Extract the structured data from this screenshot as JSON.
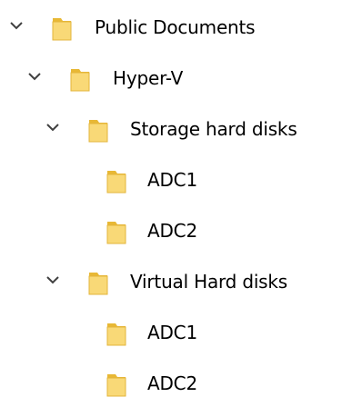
{
  "tree": {
    "items": [
      {
        "label": "Public Documents",
        "expanded": true,
        "level": 0,
        "icon": "folder-icon"
      },
      {
        "label": "Hyper-V",
        "expanded": true,
        "level": 1,
        "icon": "folder-icon"
      },
      {
        "label": "Storage hard disks",
        "expanded": true,
        "level": 2,
        "icon": "folder-icon"
      },
      {
        "label": "ADC1",
        "expanded": false,
        "level": 3,
        "icon": "folder-icon"
      },
      {
        "label": "ADC2",
        "expanded": false,
        "level": 3,
        "icon": "folder-icon"
      },
      {
        "label": "Virtual Hard disks",
        "expanded": true,
        "level": 2,
        "icon": "folder-icon"
      },
      {
        "label": "ADC1",
        "expanded": false,
        "level": 3,
        "icon": "folder-icon"
      },
      {
        "label": "ADC2",
        "expanded": false,
        "level": 3,
        "icon": "folder-icon"
      }
    ]
  },
  "colors": {
    "folder_front": "#F9D977",
    "folder_back": "#E8B835",
    "chevron": "#404040",
    "text": "#000000"
  }
}
